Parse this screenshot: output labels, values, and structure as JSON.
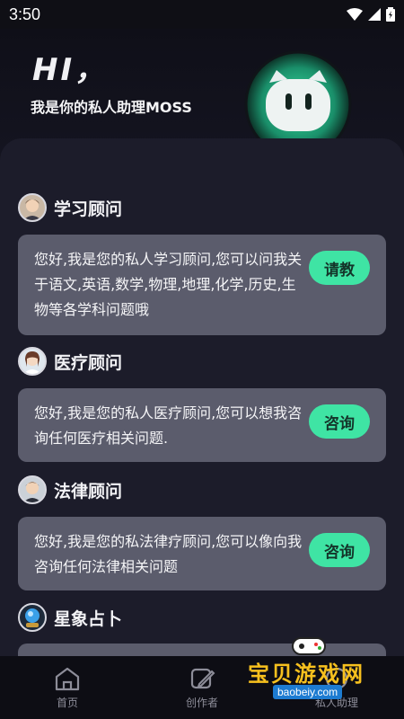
{
  "status": {
    "time": "3:50"
  },
  "header": {
    "greeting": "HI，",
    "subtitle": "我是你的私人助理MOSS"
  },
  "sections": [
    {
      "title": "学习顾问",
      "text": "您好,我是您的私人学习顾问,您可以问我关于语文,英语,数学,物理,地理,化学,历史,生物等各学科问题哦",
      "button": "请教"
    },
    {
      "title": "医疗顾问",
      "text": "您好,我是您的私人医疗顾问,您可以想我咨询任何医疗相关问题.",
      "button": "咨询"
    },
    {
      "title": "法律顾问",
      "text": "您好,我是您的私法律疗顾问,您可以像向我咨询任何法律相关问题",
      "button": "咨询"
    },
    {
      "title": "星象占卜"
    }
  ],
  "tabbar": {
    "tabs": [
      {
        "label": "首页",
        "icon": "home-icon"
      },
      {
        "label": "创作者",
        "icon": "edit-icon"
      },
      {
        "label": "私人助理",
        "icon": "assistant-icon"
      }
    ]
  },
  "watermark": {
    "brand": "宝贝游戏网",
    "url": "baobeiy.com"
  },
  "colors": {
    "accent": "#3fe4a4",
    "card": "#5b5c6c",
    "panel": "#1c1c2a"
  }
}
